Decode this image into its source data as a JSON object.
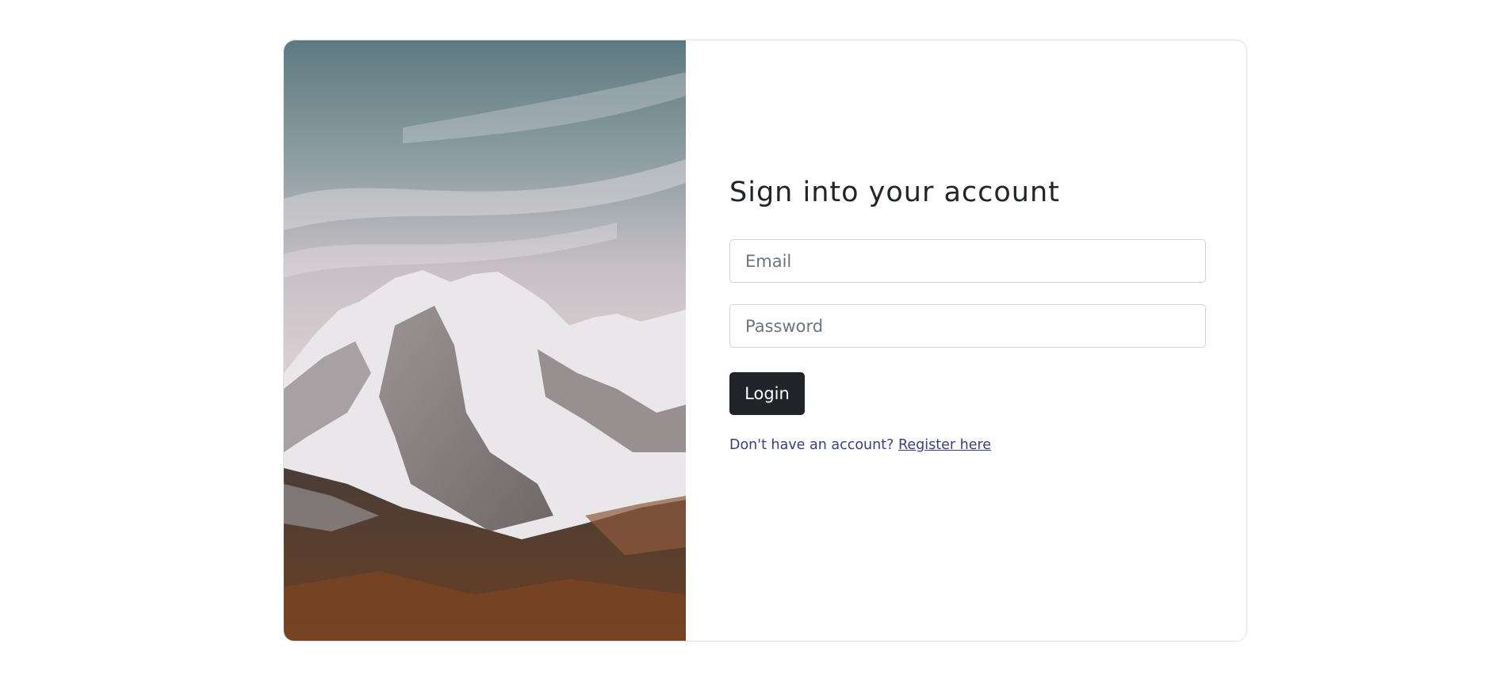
{
  "login_card": {
    "title": "Sign into your account",
    "email_placeholder": "Email",
    "email_value": "",
    "password_placeholder": "Password",
    "password_value": "",
    "login_label": "Login",
    "register_prompt": "Don't have an account?",
    "register_link": "Register here"
  },
  "image": {
    "subject": "snow-capped mountain under a cloudy sky"
  },
  "colors": {
    "button_bg": "#212529",
    "link": "#393f81",
    "border": "#dee2e6"
  }
}
